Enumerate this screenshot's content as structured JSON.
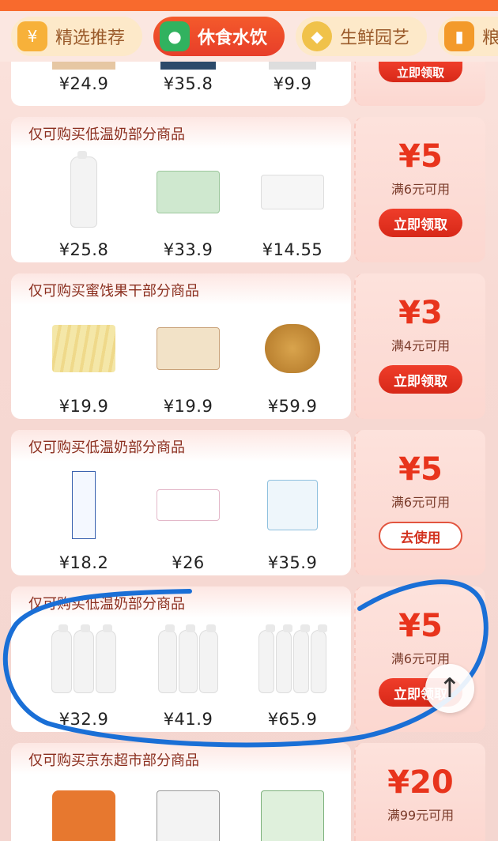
{
  "tabs": [
    {
      "label": "精选推荐",
      "icon": "coupon-icon",
      "active": false
    },
    {
      "label": "休食水饮",
      "icon": "snack-icon",
      "active": true
    },
    {
      "label": "生鲜园艺",
      "icon": "durian-icon",
      "active": false
    },
    {
      "label": "粮",
      "icon": "grain-icon",
      "active": false
    }
  ],
  "coupons": [
    {
      "title": "",
      "prices": [
        "¥24.9",
        "¥35.8",
        "¥9.9"
      ],
      "amount": "",
      "condition": "",
      "button": "立即领取"
    },
    {
      "title": "仅可购买低温奶部分商品",
      "prices": [
        "¥25.8",
        "¥33.9",
        "¥14.55"
      ],
      "amount": "¥5",
      "condition": "满6元可用",
      "button": "立即领取"
    },
    {
      "title": "仅可购买蜜饯果干部分商品",
      "prices": [
        "¥19.9",
        "¥19.9",
        "¥59.9"
      ],
      "amount": "¥3",
      "condition": "满4元可用",
      "button": "立即领取"
    },
    {
      "title": "仅可购买低温奶部分商品",
      "prices": [
        "¥18.2",
        "¥26",
        "¥35.9"
      ],
      "amount": "¥5",
      "condition": "满6元可用",
      "button": "去使用"
    },
    {
      "title": "仅可购买低温奶部分商品",
      "prices": [
        "¥32.9",
        "¥41.9",
        "¥65.9"
      ],
      "amount": "¥5",
      "condition": "满6元可用",
      "button": "立即领取"
    },
    {
      "title": "仅可购买京东超市部分商品",
      "prices": [],
      "amount": "¥20",
      "condition": "满99元可用",
      "button": ""
    }
  ],
  "scroll_top_icon": "arrow-up-icon",
  "colors": {
    "accent": "#e8341c",
    "topbar": "#f86a2d",
    "annotation": "#1a6fd6"
  }
}
